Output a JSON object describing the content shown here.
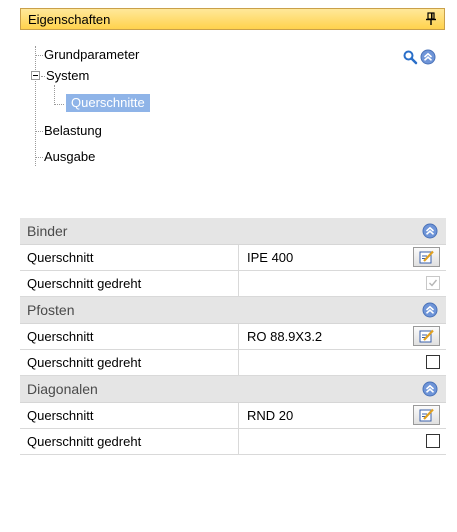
{
  "panel": {
    "title": "Eigenschaften",
    "pin_icon": "pin-icon"
  },
  "tree": {
    "items": [
      {
        "label": "Grundparameter"
      },
      {
        "label": "System"
      },
      {
        "label": "Querschnitte"
      },
      {
        "label": "Belastung"
      },
      {
        "label": "Ausgabe"
      }
    ],
    "selected": "Querschnitte",
    "tools": {
      "search_icon": "search-icon",
      "collapse_icon": "chevron-double-up-icon"
    }
  },
  "sections": [
    {
      "title": "Binder",
      "rows": [
        {
          "name": "Querschnitt",
          "value": "IPE 400",
          "control": "edit-button"
        },
        {
          "name": "Querschnitt gedreht",
          "checked": true,
          "enabled": false
        }
      ]
    },
    {
      "title": "Pfosten",
      "rows": [
        {
          "name": "Querschnitt",
          "value": "RO 88.9X3.2",
          "control": "edit-button"
        },
        {
          "name": "Querschnitt gedreht",
          "checked": false,
          "enabled": true
        }
      ]
    },
    {
      "title": "Diagonalen",
      "rows": [
        {
          "name": "Querschnitt",
          "value": "RND 20",
          "control": "edit-button"
        },
        {
          "name": "Querschnitt gedreht",
          "checked": false,
          "enabled": true
        }
      ]
    }
  ],
  "colors": {
    "header_bg": "#ffd24d",
    "section_bg": "#e5e5e5",
    "selection": "#8fb4e8",
    "accent_blue": "#6f95d8"
  }
}
